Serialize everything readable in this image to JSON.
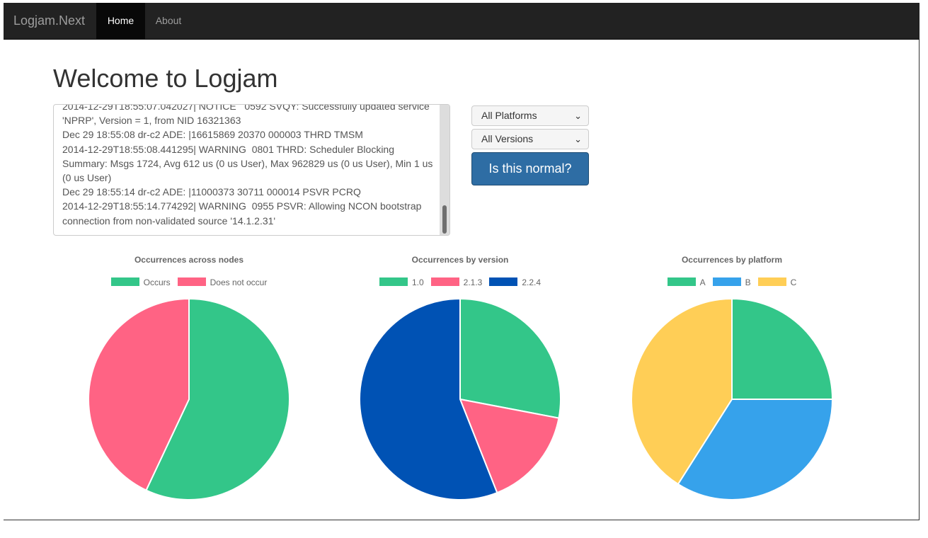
{
  "navbar": {
    "brand": "Logjam.Next",
    "home_label": "Home",
    "about_label": "About"
  },
  "page_title": "Welcome to Logjam",
  "log_lines": "2014-12-29T18:55:07.042027| NOTICE   0592 SVQY: Successfully updated service 'NPRP', Version = 1, from NID 16321363\nDec 29 18:55:08 dr-c2 ADE: |16615869 20370 000003 THRD TMSM\n2014-12-29T18:55:08.441295| WARNING  0801 THRD: Scheduler Blocking Summary: Msgs 1724, Avg 612 us (0 us User), Max 962829 us (0 us User), Min 1 us (0 us User)\nDec 29 18:55:14 dr-c2 ADE: |11000373 30711 000014 PSVR PCRQ\n2014-12-29T18:55:14.774292| WARNING  0955 PSVR: Allowing NCON bootstrap connection from non-validated source '14.1.2.31'",
  "filters": {
    "platform_selected": "All Platforms",
    "version_selected": "All Versions",
    "chevron": "⌄"
  },
  "action_button_label": "Is this normal?",
  "colors": {
    "green": "#33c689",
    "pink": "#ff6384",
    "dark_blue": "#0052b4",
    "light_blue": "#36a2eb",
    "yellow": "#ffce56"
  },
  "chart_data": [
    {
      "type": "pie",
      "title": "Occurrences across nodes",
      "categories": [
        "Occurs",
        "Does not occur"
      ],
      "values": [
        57,
        43
      ],
      "colors": [
        "#33c689",
        "#ff6384"
      ],
      "legend": "top"
    },
    {
      "type": "pie",
      "title": "Occurrences by version",
      "categories": [
        "1.0",
        "2.1.3",
        "2.2.4"
      ],
      "values": [
        28,
        16,
        56
      ],
      "colors": [
        "#33c689",
        "#ff6384",
        "#0052b4"
      ],
      "legend": "top"
    },
    {
      "type": "pie",
      "title": "Occurrences by platform",
      "categories": [
        "A",
        "B",
        "C"
      ],
      "values": [
        25,
        34,
        41
      ],
      "colors": [
        "#33c689",
        "#36a2eb",
        "#ffce56"
      ],
      "legend": "top"
    }
  ]
}
